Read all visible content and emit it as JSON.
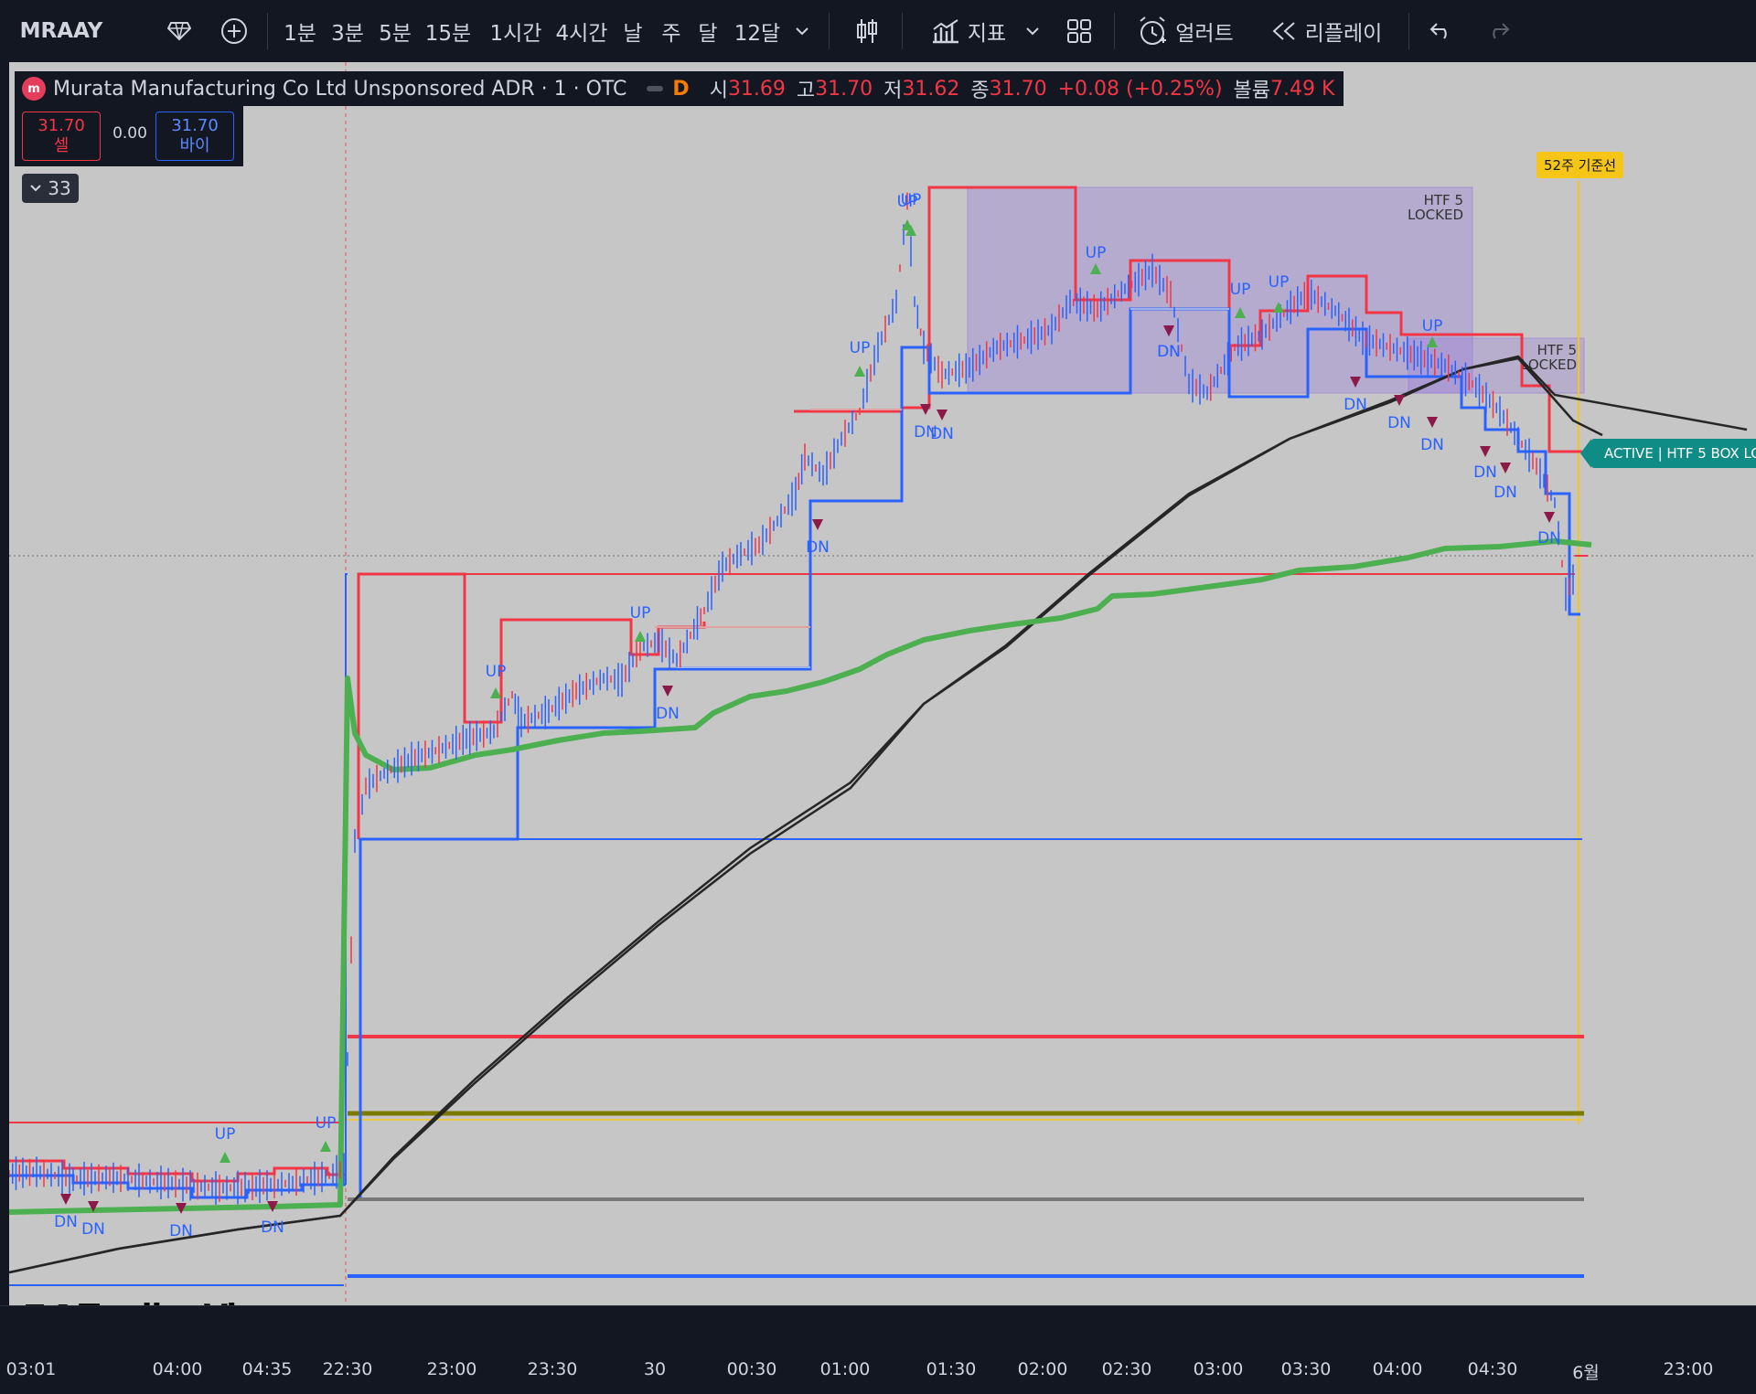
{
  "toolbar": {
    "symbol": "MRAAY",
    "intervals": [
      "1분",
      "3분",
      "5분",
      "15분",
      "1시간",
      "4시간",
      "날",
      "주",
      "달",
      "12달"
    ],
    "indicators_label": "지표",
    "alerts_label": "얼러트",
    "replay_label": "리플레이"
  },
  "legend": {
    "logo_text": "m",
    "title": "Murata Manufacturing Co Ltd Unsponsored ADR · 1 · OTC",
    "flag": "D",
    "open_label": "시",
    "open": "31.69",
    "high_label": "고",
    "high": "31.70",
    "low_label": "저",
    "low": "31.62",
    "close_label": "종",
    "close": "31.70",
    "change": "+0.08 (+0.25%)",
    "volume_label": "볼륨",
    "volume": "7.49 K"
  },
  "trade": {
    "sell_price": "31.70",
    "sell_label": "셀",
    "spread": "0.00",
    "buy_price": "31.70",
    "buy_label": "바이"
  },
  "collapse_count": "33",
  "flags": {
    "week52": "52주 기준선",
    "active": "ACTIVE | HTF 5 BOX LO"
  },
  "boxes": [
    {
      "label1": "HTF 5",
      "label2": "LOCKED"
    },
    {
      "label1": "HTF 5",
      "label2": "LOCKED"
    }
  ],
  "markers": {
    "up": [
      {
        "t": "UP"
      },
      {
        "t": "UP"
      },
      {
        "t": "UP"
      },
      {
        "t": "UP"
      },
      {
        "t": "UP"
      },
      {
        "t": "UP"
      },
      {
        "t": "UP"
      },
      {
        "t": "UP"
      },
      {
        "t": "UP"
      },
      {
        "t": "UP"
      },
      {
        "t": "UP"
      }
    ],
    "dn": [
      {
        "t": "DN"
      },
      {
        "t": "DN"
      },
      {
        "t": "DN"
      },
      {
        "t": "DN"
      },
      {
        "t": "DN"
      },
      {
        "t": "DN"
      },
      {
        "t": "DN"
      },
      {
        "t": "DN"
      },
      {
        "t": "DN"
      },
      {
        "t": "DN"
      },
      {
        "t": "DN"
      },
      {
        "t": "DN"
      },
      {
        "t": "DN"
      },
      {
        "t": "DN"
      },
      {
        "t": "DN"
      },
      {
        "t": "DN"
      }
    ]
  },
  "time_axis": [
    "03:01",
    "04:00",
    "04:35",
    "22:30",
    "23:00",
    "23:30",
    "30",
    "00:30",
    "01:00",
    "01:30",
    "02:00",
    "02:30",
    "03:00",
    "03:30",
    "04:00",
    "04:30",
    "6월",
    "23:00"
  ],
  "watermark": "TradingView",
  "colors": {
    "bg": "#131722",
    "chart_bg": "#c6c6c6",
    "red": "#f23645",
    "blue": "#2962ff",
    "green": "#4caf50",
    "olive": "#7a7a00"
  }
}
